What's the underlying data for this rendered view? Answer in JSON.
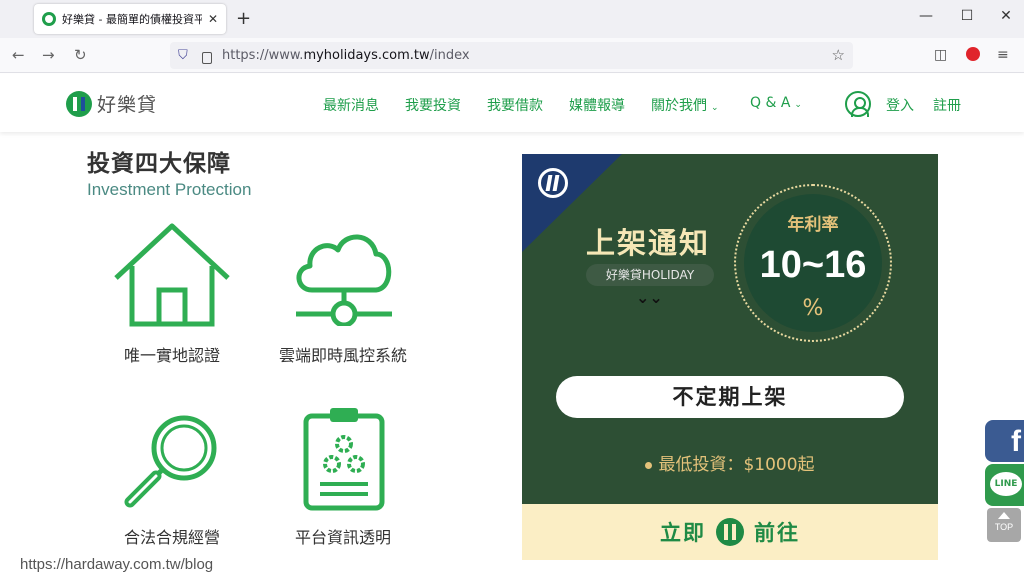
{
  "browser": {
    "tab_title": "好樂貸 - 最簡單的債權投資平台",
    "tab_close": "✕",
    "new_tab": "+",
    "url_prefix": "https://www.",
    "url_domain": "myholidays.com.tw",
    "url_path": "/index",
    "back": "←",
    "forward": "→",
    "reload": "↻",
    "minimize": "—",
    "maximize": "☐",
    "close": "✕",
    "menu": "≡",
    "pocket": "◫",
    "star": "☆",
    "shield": "⛉"
  },
  "header": {
    "logo_text": "好樂貸",
    "nav": [
      {
        "label": "最新消息"
      },
      {
        "label": "我要投資"
      },
      {
        "label": "我要借款"
      },
      {
        "label": "媒體報導"
      },
      {
        "label": "關於我們",
        "chev": "⌄"
      },
      {
        "label": "Q & A",
        "chev": "⌄"
      }
    ],
    "login": "登入",
    "register": "註冊",
    "accent": "#1f9e4b"
  },
  "section": {
    "title": "投資四大保障",
    "subtitle": "Investment Protection",
    "features": [
      {
        "label": "唯一實地認證",
        "icon": "house-icon"
      },
      {
        "label": "雲端即時風控系統",
        "icon": "cloud-network-icon"
      },
      {
        "label": "合法合規經營",
        "icon": "magnifier-icon"
      },
      {
        "label": "平台資訊透明",
        "icon": "clipboard-gears-icon"
      }
    ]
  },
  "promo": {
    "title": "上架通知",
    "brand": "好樂貸HOLIDAY",
    "chevrons": "⌄⌄",
    "rate_label": "年利率",
    "rate_value": "10~16",
    "rate_unit": "%",
    "pill": "不定期上架",
    "min_invest": "最低投資：$1000起",
    "go_left": "立即",
    "go_right": "前往"
  },
  "side": {
    "facebook": "f",
    "line": "LINE",
    "top": "TOP"
  },
  "watermark": "https://hardaway.com.tw/blog"
}
